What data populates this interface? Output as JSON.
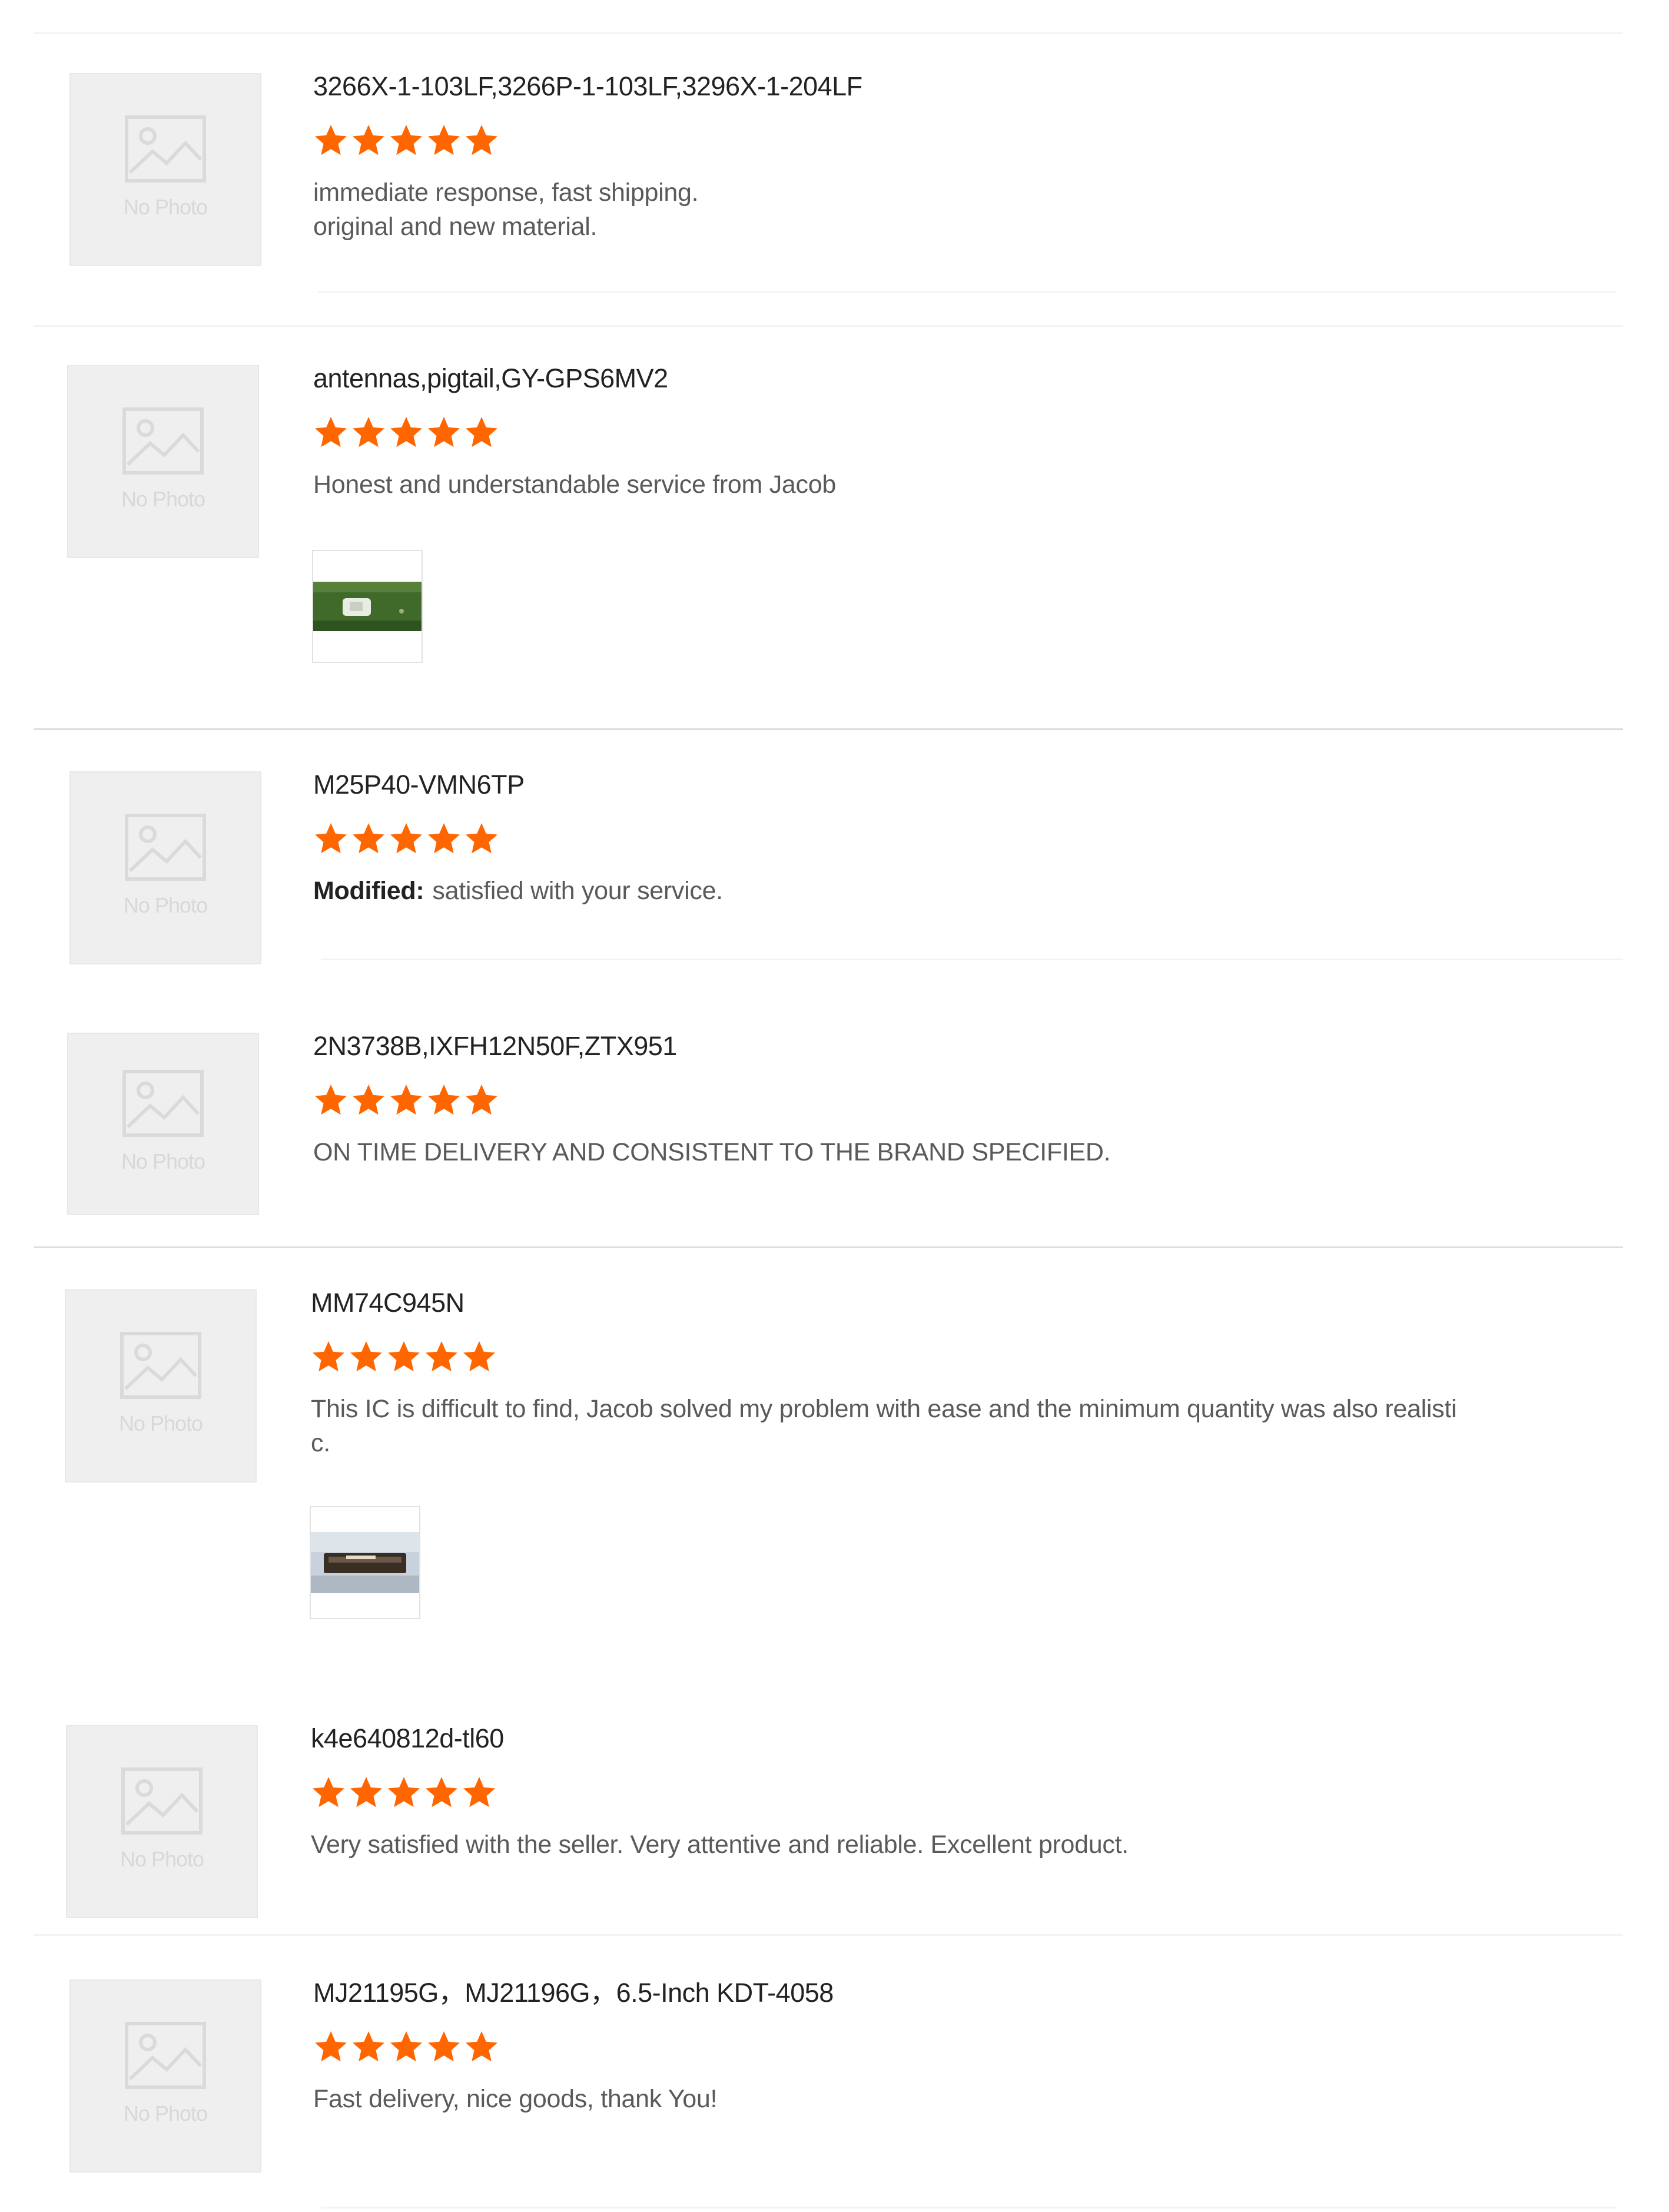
{
  "no_photo_label": "No Photo",
  "colors": {
    "star": "#ff6600",
    "divider": "#dedede"
  },
  "reviews": [
    {
      "product": "3266X-1-103LF,3266P-1-103LF,3296X-1-204LF",
      "rating": 5,
      "comment_lines": [
        "immediate response, fast shipping.",
        "original and new material."
      ]
    },
    {
      "product": "antennas,pigtail,GY-GPS6MV2",
      "rating": 5,
      "comment_lines": [
        "Honest and understandable service from Jacob"
      ],
      "attachment": "green-antenna-photo"
    },
    {
      "product": "M25P40-VMN6TP",
      "rating": 5,
      "modified_label": "Modified:",
      "comment_lines": [
        "satisfied with your service."
      ]
    },
    {
      "product": "2N3738B,IXFH12N50F,ZTX951",
      "rating": 5,
      "comment_lines": [
        "ON TIME DELIVERY AND CONSISTENT TO THE BRAND SPECIFIED."
      ]
    },
    {
      "product": "MM74C945N",
      "rating": 5,
      "comment_lines": [
        "This IC is difficult to find, Jacob solved my problem with ease and the minimum quantity was also realisti",
        "c."
      ],
      "attachment": "ic-chip-photo"
    },
    {
      "product": "k4e640812d-tl60",
      "rating": 5,
      "comment_lines": [
        "Very satisfied with the seller. Very attentive and reliable. Excellent product."
      ]
    },
    {
      "product": "MJ21195G，MJ21196G，6.5-Inch KDT-4058",
      "rating": 5,
      "comment_lines": [
        "Fast delivery, nice goods, thank You!"
      ]
    }
  ]
}
